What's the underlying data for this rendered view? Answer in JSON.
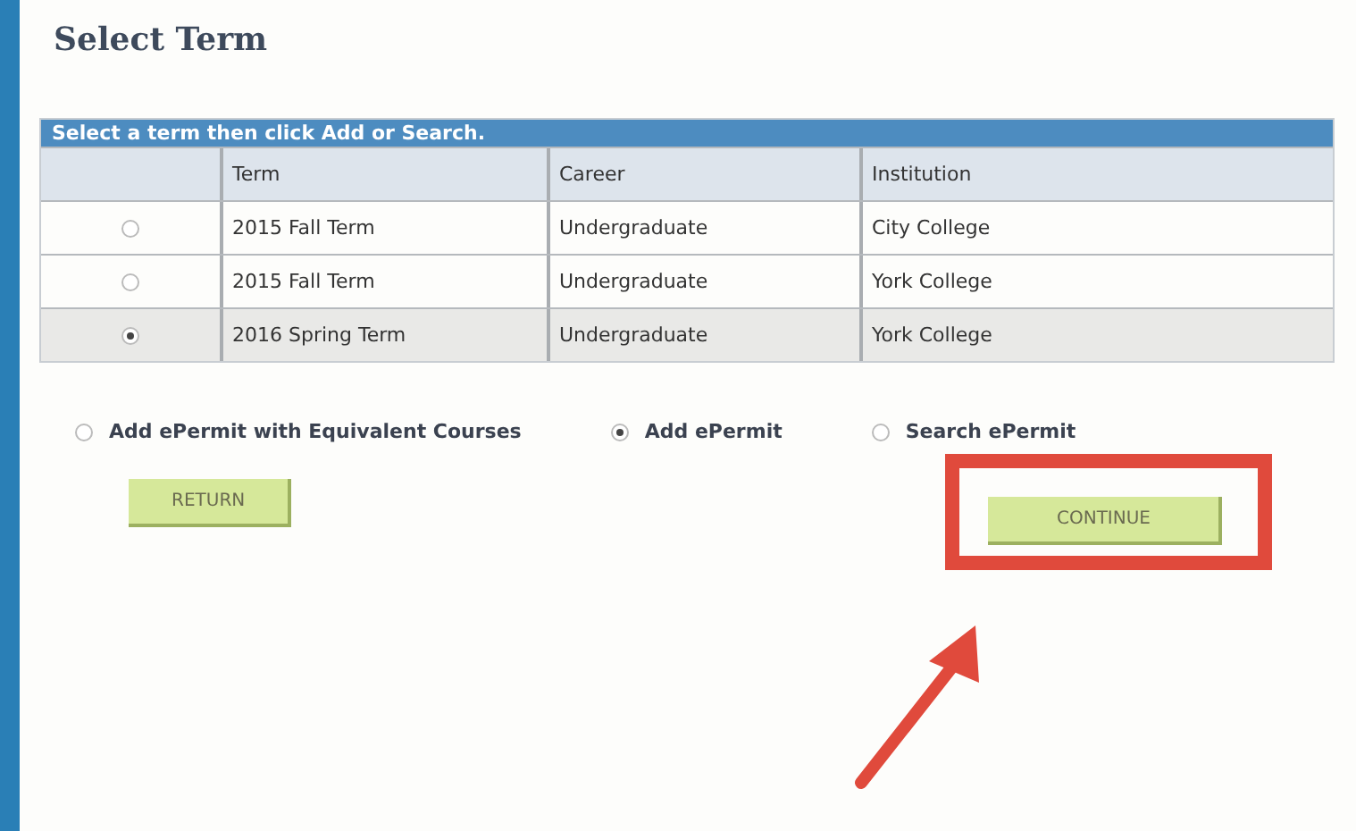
{
  "page": {
    "title": "Select Term"
  },
  "table": {
    "caption": "Select a term then click Add or Search.",
    "columns": [
      "Term",
      "Career",
      "Institution"
    ],
    "rows": [
      {
        "selected": false,
        "cells": [
          "2015 Fall Term",
          "Undergraduate",
          "City College"
        ]
      },
      {
        "selected": false,
        "cells": [
          "2015 Fall Term",
          "Undergraduate",
          "York College"
        ]
      },
      {
        "selected": true,
        "cells": [
          "2016 Spring Term",
          "Undergraduate",
          "York College"
        ]
      }
    ]
  },
  "options": [
    {
      "label": "Add ePermit with Equivalent Courses",
      "selected": false
    },
    {
      "label": "Add ePermit",
      "selected": true
    },
    {
      "label": "Search ePermit",
      "selected": false
    }
  ],
  "buttons": [
    {
      "label": "RETURN",
      "highlighted": false
    },
    {
      "label": "CONTINUE",
      "highlighted": true
    }
  ]
}
